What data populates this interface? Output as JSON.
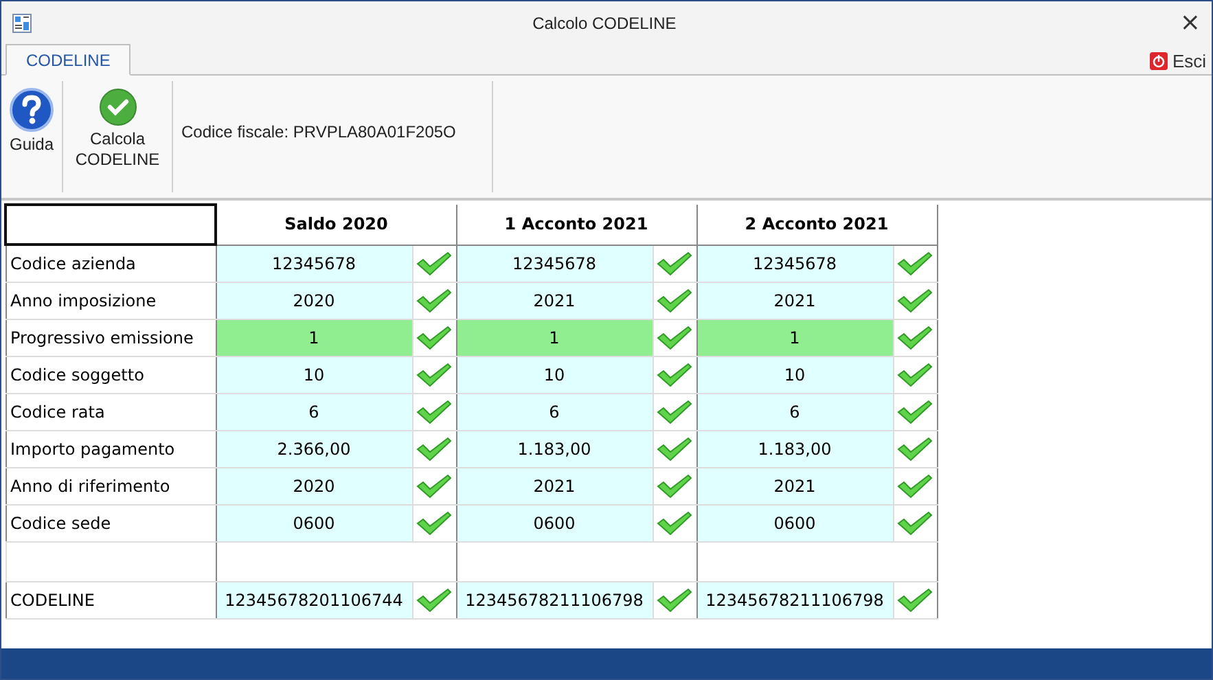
{
  "window": {
    "title": "Calcolo CODELINE",
    "close": "×"
  },
  "tabs": [
    {
      "label": "CODELINE",
      "selected": true
    }
  ],
  "exit_button": {
    "label": "Esci"
  },
  "ribbon": {
    "buttons": [
      {
        "kind": "help",
        "label": "Guida"
      },
      {
        "kind": "calc",
        "label": "Calcola CODELINE"
      }
    ],
    "fiscal_code": "Codice fiscale: PRVPLA80A01F205O"
  },
  "table": {
    "columns": [
      "Saldo 2020",
      "1 Acconto 2021",
      "2 Acconto 2021"
    ],
    "rows": [
      {
        "label": "Codice azienda",
        "highlighted": false,
        "cells": [
          {
            "value": "12345678",
            "valid": true
          },
          {
            "value": "12345678",
            "valid": true
          },
          {
            "value": "12345678",
            "valid": true
          }
        ]
      },
      {
        "label": "Anno imposizione",
        "highlighted": false,
        "cells": [
          {
            "value": "2020",
            "valid": true
          },
          {
            "value": "2021",
            "valid": true
          },
          {
            "value": "2021",
            "valid": true
          }
        ]
      },
      {
        "label": "Progressivo emissione",
        "highlighted": true,
        "cells": [
          {
            "value": "1",
            "valid": true
          },
          {
            "value": "1",
            "valid": true
          },
          {
            "value": "1",
            "valid": true
          }
        ]
      },
      {
        "label": "Codice soggetto",
        "highlighted": false,
        "cells": [
          {
            "value": "10",
            "valid": true
          },
          {
            "value": "10",
            "valid": true
          },
          {
            "value": "10",
            "valid": true
          }
        ]
      },
      {
        "label": "Codice rata",
        "highlighted": false,
        "cells": [
          {
            "value": "6",
            "valid": true
          },
          {
            "value": "6",
            "valid": true
          },
          {
            "value": "6",
            "valid": true
          }
        ]
      },
      {
        "label": "Importo pagamento",
        "highlighted": false,
        "cells": [
          {
            "value": "2.366,00",
            "valid": true
          },
          {
            "value": "1.183,00",
            "valid": true
          },
          {
            "value": "1.183,00",
            "valid": true
          }
        ]
      },
      {
        "label": "Anno di riferimento",
        "highlighted": false,
        "cells": [
          {
            "value": "2020",
            "valid": true
          },
          {
            "value": "2021",
            "valid": true
          },
          {
            "value": "2021",
            "valid": true
          }
        ]
      },
      {
        "label": "Codice sede",
        "highlighted": false,
        "cells": [
          {
            "value": "0600",
            "valid": true
          },
          {
            "value": "0600",
            "valid": true
          },
          {
            "value": "0600",
            "valid": true
          }
        ]
      }
    ],
    "codeline": {
      "label": "CODELINE",
      "highlighted": false,
      "cells": [
        {
          "value": "12345678201106744",
          "valid": true
        },
        {
          "value": "12345678211106798",
          "valid": true
        },
        {
          "value": "12345678211106798",
          "valid": true
        }
      ]
    }
  }
}
